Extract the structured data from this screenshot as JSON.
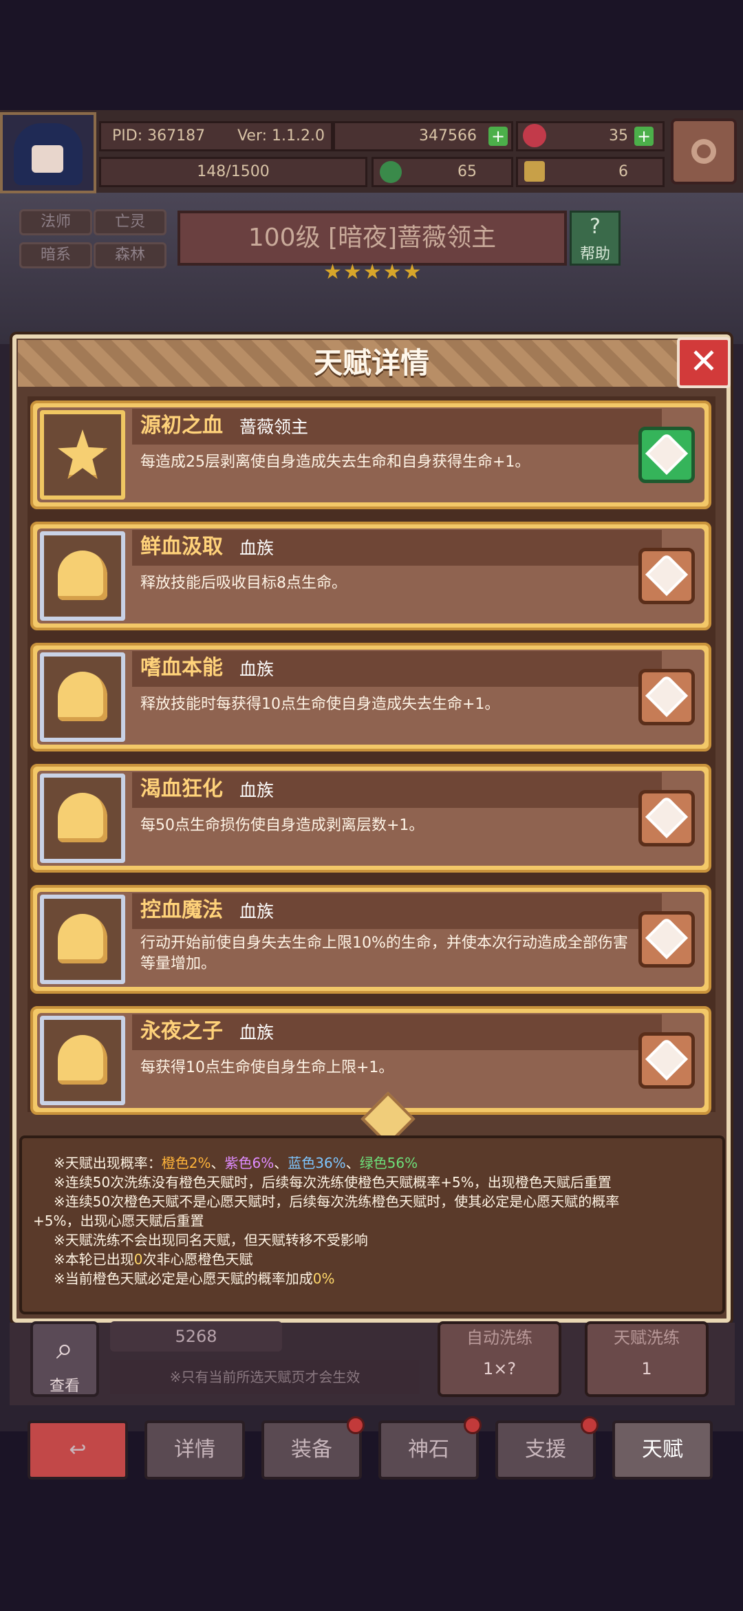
{
  "top": {
    "pid": "PID: 367187",
    "version": "Ver: 1.1.2.0",
    "gold": "347566",
    "gems": "35",
    "exp": "148/1500",
    "clover": "65",
    "keys": "6"
  },
  "hero": {
    "tags": [
      "法师",
      "亡灵",
      "暗系",
      "森林"
    ],
    "title": "100级 [暗夜]蔷薇领主",
    "help": "帮助",
    "stars": "★★★★★"
  },
  "modal": {
    "title": "天赋详情",
    "close": "✕",
    "talents": [
      {
        "name": "源初之血",
        "tribe": "蔷薇领主",
        "desc": "每造成25层剥离使自身造成失去生命和自身获得生命+1。"
      },
      {
        "name": "鲜血汲取",
        "tribe": "血族",
        "desc": "释放技能后吸收目标8点生命。"
      },
      {
        "name": "嗜血本能",
        "tribe": "血族",
        "desc": "释放技能时每获得10点生命使自身造成失去生命+1。"
      },
      {
        "name": "渴血狂化",
        "tribe": "血族",
        "desc": "每50点生命损伤使自身造成剥离层数+1。"
      },
      {
        "name": "控血魔法",
        "tribe": "血族",
        "desc": "行动开始前使自身失去生命上限10%的生命，并使本次行动造成全部伤害等量增加。"
      },
      {
        "name": "永夜之子",
        "tribe": "血族",
        "desc": "每获得10点生命使自身生命上限+1。"
      }
    ],
    "notes": {
      "prob_prefix": "※天赋出现概率：",
      "orange": "橙色2%",
      "sep1": "、",
      "purple": "紫色6%",
      "sep2": "、",
      "blue": "蓝色36%",
      "sep3": "、",
      "green": "绿色56%",
      "line2": "※连续50次洗练没有橙色天赋时，后续每次洗练使橙色天赋概率+5%，出现橙色天赋后重置",
      "line3a": "※连续50次橙色天赋不是心愿天赋时，后续每次洗练橙色天赋时，使其必定是心愿天赋的概率",
      "line3b": "+5%，出现心愿天赋后重置",
      "line4": "※天赋洗练不会出现同名天赋，但天赋转移不受影响",
      "line5_pre": "※本轮已出现",
      "line5_num": "0",
      "line5_post": "次非心愿橙色天赋",
      "line6_pre": "※当前橙色天赋必定是心愿天赋的概率加成",
      "line6_num": "0%"
    }
  },
  "bottom": {
    "view": "查看",
    "count": "5268",
    "hint": "※只有当前所选天赋页才会生效",
    "auto_reroll": "自动洗练",
    "auto_cost": "1×?",
    "talent_reroll": "天赋洗练",
    "talent_cost": "1",
    "nav": [
      "↩",
      "详情",
      "装备",
      "神石",
      "支援",
      "天赋"
    ]
  }
}
